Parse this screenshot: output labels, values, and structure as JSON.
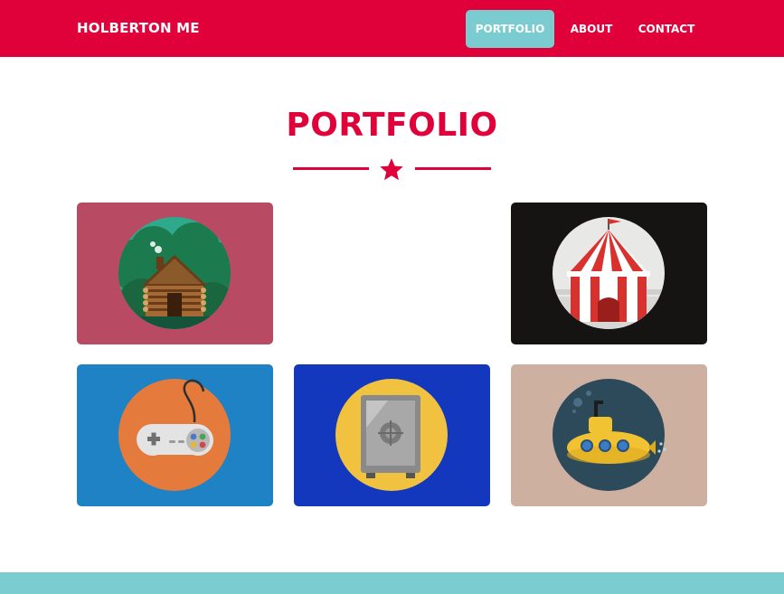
{
  "navbar": {
    "brand": "HOLBERTON ME",
    "items": [
      {
        "label": "PORTFOLIO",
        "active": true
      },
      {
        "label": "ABOUT"
      },
      {
        "label": "CONTACT"
      }
    ],
    "background": "#e0003a",
    "active_color": "#7accd0"
  },
  "portfolio": {
    "title": "PORTFOLIO",
    "divider_icon": "star-icon",
    "accent": "#e0003a",
    "tiles": [
      {
        "icon": "log-cabin-icon",
        "background": "#b84b63"
      },
      {
        "icon": "circus-tent-icon",
        "background": "#161313"
      },
      {
        "icon": "game-controller-icon",
        "background": "#1e82c4"
      },
      {
        "icon": "safe-icon",
        "background": "#1338bd"
      },
      {
        "icon": "submarine-icon",
        "background": "#ceb0a1"
      }
    ]
  },
  "footer": {
    "background": "#7accd0"
  }
}
